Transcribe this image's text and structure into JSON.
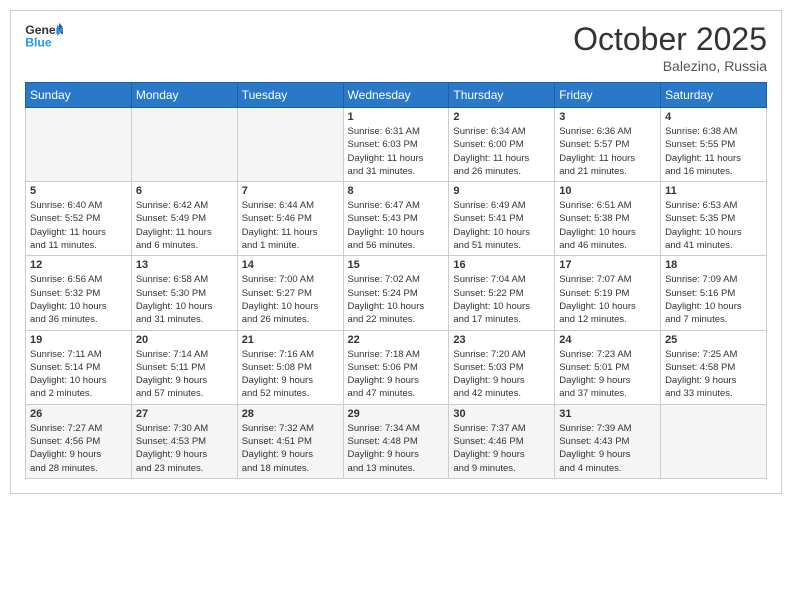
{
  "header": {
    "logo": {
      "line1": "General",
      "line2": "Blue"
    },
    "title": "October 2025",
    "location": "Balezino, Russia"
  },
  "weekdays": [
    "Sunday",
    "Monday",
    "Tuesday",
    "Wednesday",
    "Thursday",
    "Friday",
    "Saturday"
  ],
  "weeks": [
    [
      {
        "day": "",
        "info": ""
      },
      {
        "day": "",
        "info": ""
      },
      {
        "day": "",
        "info": ""
      },
      {
        "day": "1",
        "info": "Sunrise: 6:31 AM\nSunset: 6:03 PM\nDaylight: 11 hours\nand 31 minutes."
      },
      {
        "day": "2",
        "info": "Sunrise: 6:34 AM\nSunset: 6:00 PM\nDaylight: 11 hours\nand 26 minutes."
      },
      {
        "day": "3",
        "info": "Sunrise: 6:36 AM\nSunset: 5:57 PM\nDaylight: 11 hours\nand 21 minutes."
      },
      {
        "day": "4",
        "info": "Sunrise: 6:38 AM\nSunset: 5:55 PM\nDaylight: 11 hours\nand 16 minutes."
      }
    ],
    [
      {
        "day": "5",
        "info": "Sunrise: 6:40 AM\nSunset: 5:52 PM\nDaylight: 11 hours\nand 11 minutes."
      },
      {
        "day": "6",
        "info": "Sunrise: 6:42 AM\nSunset: 5:49 PM\nDaylight: 11 hours\nand 6 minutes."
      },
      {
        "day": "7",
        "info": "Sunrise: 6:44 AM\nSunset: 5:46 PM\nDaylight: 11 hours\nand 1 minute."
      },
      {
        "day": "8",
        "info": "Sunrise: 6:47 AM\nSunset: 5:43 PM\nDaylight: 10 hours\nand 56 minutes."
      },
      {
        "day": "9",
        "info": "Sunrise: 6:49 AM\nSunset: 5:41 PM\nDaylight: 10 hours\nand 51 minutes."
      },
      {
        "day": "10",
        "info": "Sunrise: 6:51 AM\nSunset: 5:38 PM\nDaylight: 10 hours\nand 46 minutes."
      },
      {
        "day": "11",
        "info": "Sunrise: 6:53 AM\nSunset: 5:35 PM\nDaylight: 10 hours\nand 41 minutes."
      }
    ],
    [
      {
        "day": "12",
        "info": "Sunrise: 6:56 AM\nSunset: 5:32 PM\nDaylight: 10 hours\nand 36 minutes."
      },
      {
        "day": "13",
        "info": "Sunrise: 6:58 AM\nSunset: 5:30 PM\nDaylight: 10 hours\nand 31 minutes."
      },
      {
        "day": "14",
        "info": "Sunrise: 7:00 AM\nSunset: 5:27 PM\nDaylight: 10 hours\nand 26 minutes."
      },
      {
        "day": "15",
        "info": "Sunrise: 7:02 AM\nSunset: 5:24 PM\nDaylight: 10 hours\nand 22 minutes."
      },
      {
        "day": "16",
        "info": "Sunrise: 7:04 AM\nSunset: 5:22 PM\nDaylight: 10 hours\nand 17 minutes."
      },
      {
        "day": "17",
        "info": "Sunrise: 7:07 AM\nSunset: 5:19 PM\nDaylight: 10 hours\nand 12 minutes."
      },
      {
        "day": "18",
        "info": "Sunrise: 7:09 AM\nSunset: 5:16 PM\nDaylight: 10 hours\nand 7 minutes."
      }
    ],
    [
      {
        "day": "19",
        "info": "Sunrise: 7:11 AM\nSunset: 5:14 PM\nDaylight: 10 hours\nand 2 minutes."
      },
      {
        "day": "20",
        "info": "Sunrise: 7:14 AM\nSunset: 5:11 PM\nDaylight: 9 hours\nand 57 minutes."
      },
      {
        "day": "21",
        "info": "Sunrise: 7:16 AM\nSunset: 5:08 PM\nDaylight: 9 hours\nand 52 minutes."
      },
      {
        "day": "22",
        "info": "Sunrise: 7:18 AM\nSunset: 5:06 PM\nDaylight: 9 hours\nand 47 minutes."
      },
      {
        "day": "23",
        "info": "Sunrise: 7:20 AM\nSunset: 5:03 PM\nDaylight: 9 hours\nand 42 minutes."
      },
      {
        "day": "24",
        "info": "Sunrise: 7:23 AM\nSunset: 5:01 PM\nDaylight: 9 hours\nand 37 minutes."
      },
      {
        "day": "25",
        "info": "Sunrise: 7:25 AM\nSunset: 4:58 PM\nDaylight: 9 hours\nand 33 minutes."
      }
    ],
    [
      {
        "day": "26",
        "info": "Sunrise: 7:27 AM\nSunset: 4:56 PM\nDaylight: 9 hours\nand 28 minutes."
      },
      {
        "day": "27",
        "info": "Sunrise: 7:30 AM\nSunset: 4:53 PM\nDaylight: 9 hours\nand 23 minutes."
      },
      {
        "day": "28",
        "info": "Sunrise: 7:32 AM\nSunset: 4:51 PM\nDaylight: 9 hours\nand 18 minutes."
      },
      {
        "day": "29",
        "info": "Sunrise: 7:34 AM\nSunset: 4:48 PM\nDaylight: 9 hours\nand 13 minutes."
      },
      {
        "day": "30",
        "info": "Sunrise: 7:37 AM\nSunset: 4:46 PM\nDaylight: 9 hours\nand 9 minutes."
      },
      {
        "day": "31",
        "info": "Sunrise: 7:39 AM\nSunset: 4:43 PM\nDaylight: 9 hours\nand 4 minutes."
      },
      {
        "day": "",
        "info": ""
      }
    ]
  ]
}
